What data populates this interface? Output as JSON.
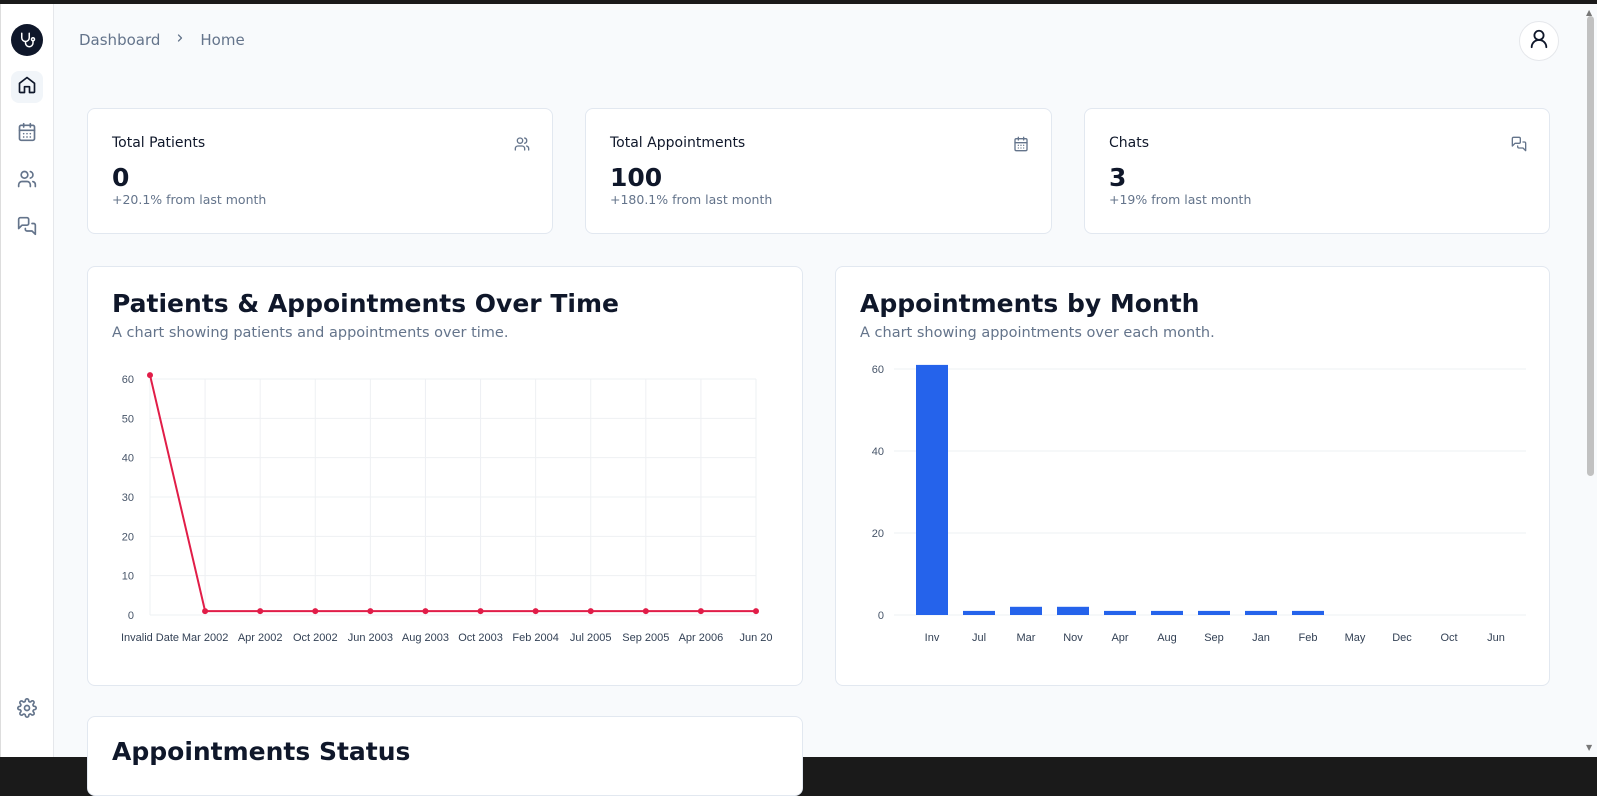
{
  "breadcrumb": {
    "items": [
      "Dashboard",
      "Home"
    ]
  },
  "nav": {
    "items": [
      {
        "name": "home",
        "icon": "home-icon"
      },
      {
        "name": "appointments",
        "icon": "calendar-icon"
      },
      {
        "name": "patients",
        "icon": "users-icon"
      },
      {
        "name": "chats",
        "icon": "chat-icon"
      }
    ],
    "settings_icon": "gear-icon"
  },
  "stats": [
    {
      "title": "Total Patients",
      "value": "0",
      "sub": "+20.1% from last month",
      "icon": "users-icon"
    },
    {
      "title": "Total Appointments",
      "value": "100",
      "sub": "+180.1% from last month",
      "icon": "calendar-icon"
    },
    {
      "title": "Chats",
      "value": "3",
      "sub": "+19% from last month",
      "icon": "chat-icon"
    }
  ],
  "charts": {
    "line": {
      "title": "Patients & Appointments Over Time",
      "subtitle": "A chart showing patients and appointments over time."
    },
    "bar": {
      "title": "Appointments by Month",
      "subtitle": "A chart showing appointments over each month."
    },
    "status": {
      "title": "Appointments Status"
    }
  },
  "colors": {
    "line": "#e11d48",
    "bar": "#2563eb"
  },
  "chart_data": [
    {
      "type": "line",
      "title": "Patients & Appointments Over Time",
      "categories": [
        "Invalid Date",
        "Mar 2002",
        "Apr 2002",
        "Oct 2002",
        "Jun 2003",
        "Aug 2003",
        "Oct 2003",
        "Feb 2004",
        "Jul 2005",
        "Sep 2005",
        "Apr 2006",
        "Jun 20"
      ],
      "values": [
        61,
        1,
        1,
        1,
        1,
        1,
        1,
        1,
        1,
        1,
        1,
        1
      ],
      "yticks": [
        0,
        10,
        20,
        30,
        40,
        50,
        60
      ],
      "ylim": [
        0,
        60
      ],
      "grid": true
    },
    {
      "type": "bar",
      "title": "Appointments by Month",
      "categories": [
        "Inv",
        "Jul",
        "Mar",
        "Nov",
        "Apr",
        "Aug",
        "Sep",
        "Jan",
        "Feb",
        "May",
        "Dec",
        "Oct",
        "Jun"
      ],
      "values": [
        61,
        1,
        2,
        2,
        1,
        1,
        1,
        1,
        1,
        0,
        0,
        0,
        0
      ],
      "yticks": [
        0,
        20,
        40,
        60
      ],
      "ylim": [
        0,
        60
      ],
      "grid": true
    }
  ]
}
